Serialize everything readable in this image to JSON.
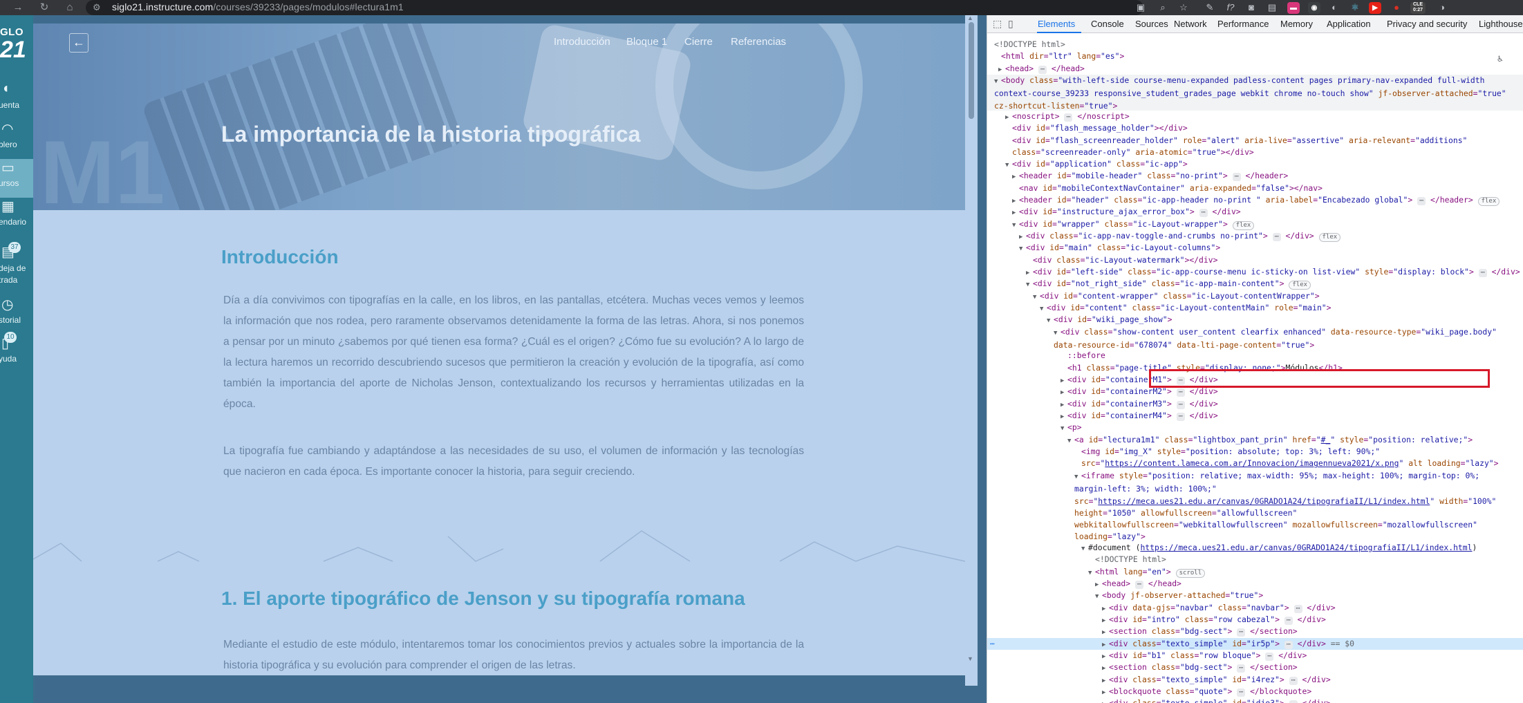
{
  "browser": {
    "url_domain": "siglo21.instructure.com",
    "url_path": "/courses/39233/pages/modulos#lectura1m1",
    "back_icon": "arrow-left-icon",
    "ext_badge": "CLE 0:27"
  },
  "canvas_nav": {
    "logo_line1": "GLO",
    "logo_line2": "21",
    "items": [
      {
        "label": "uenta",
        "icon": "account-icon"
      },
      {
        "label": "blero",
        "icon": "dashboard-icon"
      },
      {
        "label": "ursos",
        "icon": "courses-icon"
      },
      {
        "label": "endario",
        "icon": "calendar-icon"
      },
      {
        "label": "deja de\ntrada",
        "icon": "inbox-icon",
        "badge": "37"
      },
      {
        "label": "storial",
        "icon": "history-icon"
      },
      {
        "label": "yuda",
        "icon": "help-icon",
        "badge": "10"
      }
    ]
  },
  "page": {
    "nav": [
      "Introducción",
      "Bloque 1",
      "Cierre",
      "Referencias"
    ],
    "banner_title": "La importancia de la historia tipográfica",
    "banner_watermark": "M1",
    "intro_title": "Introducción",
    "intro_p1": "Día a día convivimos con tipografías en la calle, en los libros, en las pantallas, etcétera. Muchas veces vemos y leemos la información que nos rodea, pero raramente observamos detenidamente la forma de las letras. Ahora, si nos ponemos a pensar por un minuto ¿sabemos por qué tienen esa forma? ¿Cuál es el origen? ¿Cómo fue su evolución? A lo largo de la lectura haremos un recorrido descubriendo sucesos que permitieron la creación y evolución de la tipografía, así como también la importancia del aporte de Nicholas Jenson, contextualizando los recursos y herramientas utilizadas en la época.",
    "intro_p2": "La tipografía fue cambiando y adaptándose a las necesidades de su uso, el volumen de información y las tecnologías que nacieron en cada época. Es importante conocer la historia, para seguir creciendo.",
    "section1_title": "1. El aporte tipográfico de Jenson y su tipografía romana",
    "section1_p1": "Mediante el estudio de este módulo, intentaremos tomar los conocimientos previos y actuales sobre la importancia de la historia tipográfica y su evolución para comprender el origen de las letras."
  },
  "devtools": {
    "tabs": [
      "Elements",
      "Console",
      "Sources",
      "Network",
      "Performance",
      "Memory",
      "Application",
      "Privacy and security",
      "Lighthouse"
    ],
    "selected_tab": "Elements",
    "selected_node_marker": "== $0",
    "document_url": "https://meca.ues21.edu.ar/canvas/0GRADO1A24/tipografiaII/L1/index.html"
  }
}
